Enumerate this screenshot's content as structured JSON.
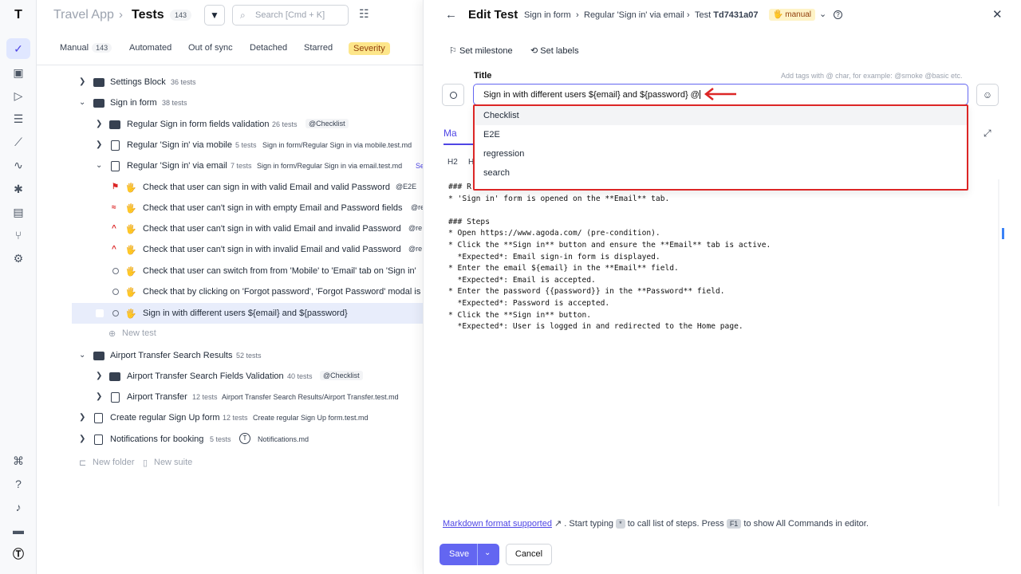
{
  "rail": {
    "icons": [
      "logo-icon",
      "check-icon",
      "briefcase-icon",
      "play-icon",
      "list-check-icon",
      "steps-icon",
      "pulse-icon",
      "bug-icon",
      "chart-icon",
      "branch-icon",
      "gear-icon",
      "command-icon",
      "help-icon",
      "bell-icon",
      "folder-icon",
      "testomat-icon"
    ]
  },
  "header": {
    "project": "Travel App",
    "sep": "›",
    "title": "Tests",
    "count": "143",
    "search_placeholder": "Search [Cmd + K]"
  },
  "tabs": [
    {
      "label": "Manual",
      "count": "143"
    },
    {
      "label": "Automated"
    },
    {
      "label": "Out of sync"
    },
    {
      "label": "Detached"
    },
    {
      "label": "Starred"
    },
    {
      "label": "Severity"
    }
  ],
  "tree": [
    {
      "label": "Settings Block",
      "meta": "36 tests"
    },
    {
      "label": "Sign in form",
      "meta": "38 tests"
    },
    {
      "label": "Regular Sign in form fields validation",
      "meta": "26 tests",
      "tag": "@Checklist"
    },
    {
      "label": "Regular 'Sign in' via mobile",
      "meta": "5 tests",
      "path": "Sign in form/Regular Sign in via mobile.test.md"
    },
    {
      "label": "Regular 'Sign in' via email",
      "meta": "7 tests",
      "path": "Sign in form/Regular Sign in via email.test.md",
      "extra": "Se"
    },
    {
      "label": "Check that user can sign in with valid Email and valid Password",
      "tag": "@E2E"
    },
    {
      "label": "Check that user can't sign in with empty Email and Password fields",
      "tag": "@re"
    },
    {
      "label": "Check that user can't sign in with valid Email and invalid Password",
      "tag": "@re"
    },
    {
      "label": "Check that user can't sign in with invalid Email and valid Password",
      "tag": "@re"
    },
    {
      "label": "Check that user can switch from from 'Mobile' to 'Email' tab on 'Sign in'"
    },
    {
      "label": "Check that by clicking on 'Forgot password', 'Forgot Password' modal is"
    },
    {
      "label": "Sign in with different users ${email} and ${password}"
    },
    {
      "label": "New test"
    },
    {
      "label": "Airport Transfer Search Results",
      "meta": "52 tests"
    },
    {
      "label": "Airport Transfer Search Fields Validation",
      "meta": "40 tests",
      "tag": "@Checklist"
    },
    {
      "label": "Airport Transfer",
      "meta": "12 tests",
      "path": "Airport Transfer Search Results/Airport Transfer.test.md"
    },
    {
      "label": "Create regular Sign Up form",
      "meta": "12 tests",
      "path": "Create regular Sign Up form.test.md"
    },
    {
      "label": "Notifications for booking",
      "meta": "5 tests",
      "path": "Notifications.md"
    }
  ],
  "tree_footer": {
    "new_folder": "New folder",
    "new_suite": "New suite"
  },
  "panel": {
    "title": "Edit Test",
    "breadcrumb": [
      "Sign in form",
      "Regular 'Sign in' via email",
      "Test"
    ],
    "test_id": "Td7431a07",
    "type_badge": "manual",
    "set_milestone": "Set milestone",
    "set_labels": "Set labels",
    "title_label": "Title",
    "tags_hint": "Add tags with @ char, for example: @smoke @basic etc.",
    "title_value": "Sign in with different users ${email} and ${password} @",
    "editor_tab": "Ma",
    "toolbar": [
      "H2",
      "H"
    ],
    "suggestions": [
      "Checklist",
      "E2E",
      "regression",
      "search"
    ],
    "code_lines": [
      "### R",
      "* 'Sign in' form is opened on the **Email** tab.",
      "",
      "### Steps",
      "* Open https://www.agoda.com/ (pre-condition).",
      "* Click the **Sign in** button and ensure the **Email** tab is active.",
      "  *Expected*: Email sign-in form is displayed.",
      "* Enter the email ${email} in the **Email** field.",
      "  *Expected*: Email is accepted.",
      "* Enter the password {{password}} in the **Password** field.",
      "  *Expected*: Password is accepted.",
      "* Click the **Sign in** button.",
      "  *Expected*: User is logged in and redirected to the Home page."
    ],
    "footer_link": "Markdown format supported",
    "footer_text1": ". Start typing",
    "footer_key1": "*",
    "footer_text2": "to call list of steps. Press",
    "footer_key2": "F1",
    "footer_text3": "to show All Commands in editor.",
    "save_label": "Save",
    "cancel_label": "Cancel"
  },
  "colors": {
    "accent": "#6366f1",
    "highlight": "#dc2626",
    "badge": "#fef3c7",
    "severity": "#fde68a"
  }
}
